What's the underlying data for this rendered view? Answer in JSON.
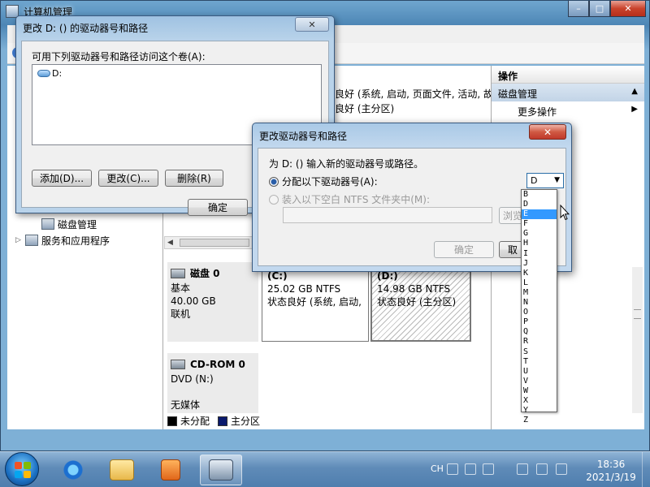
{
  "main_window": {
    "title": "计算机管理",
    "controls": {
      "minimize": "–",
      "maximize": "□",
      "close": "✕"
    }
  },
  "tree": {
    "items": [
      {
        "label": "磁盘管理",
        "icon": "disk-management-icon"
      },
      {
        "label": "服务和应用程序",
        "icon": "services-icon",
        "expander": "▷"
      }
    ]
  },
  "volume_list": {
    "status_rows": [
      "良好 (系统, 启动, 页面文件, 活动, 故",
      "良好 (主分区)"
    ]
  },
  "disks": [
    {
      "name": "磁盘 0",
      "type": "基本",
      "size": "40.00 GB",
      "state": "联机",
      "partitions": [
        {
          "label": "(C:)",
          "size": "25.02 GB NTFS",
          "status": "状态良好 (系统, 启动,"
        },
        {
          "label": "(D:)",
          "size": "14.98 GB NTFS",
          "status": "状态良好 (主分区)"
        }
      ]
    },
    {
      "name": "CD-ROM 0",
      "type": "DVD (N:)",
      "media": "无媒体"
    }
  ],
  "legend": [
    {
      "label": "未分配",
      "color": "#000000"
    },
    {
      "label": "主分区",
      "color": "#0a1a6d"
    }
  ],
  "actions": {
    "header": "操作",
    "section": "磁盘管理",
    "more": "更多操作"
  },
  "dialog1": {
    "title": "更改 D: () 的驱动器号和路径",
    "close": "✕",
    "list_label": "可用下列驱动器号和路径访问这个卷(A):",
    "entries": [
      "D:"
    ],
    "buttons": {
      "add": "添加(D)...",
      "change": "更改(C)...",
      "remove": "删除(R)",
      "ok": "确定"
    }
  },
  "dialog2": {
    "title": "更改驱动器号和路径",
    "close": "✕",
    "prompt": "为 D: () 输入新的驱动器号或路径。",
    "radio_assign": "分配以下驱动器号(A):",
    "radio_mount": "装入以下空白 NTFS 文件夹中(M):",
    "browse": "浏览",
    "ok": "确定",
    "cancel": "取",
    "combo_value": "D",
    "combo_caret": "▼"
  },
  "dropdown": {
    "options": [
      "B",
      "D",
      "E",
      "F",
      "G",
      "H",
      "I",
      "J",
      "K",
      "L",
      "M",
      "N",
      "O",
      "P",
      "Q",
      "R",
      "S",
      "T",
      "U",
      "V",
      "W",
      "X",
      "Y",
      "Z"
    ],
    "selected": "E"
  },
  "taskbar": {
    "ime": "CH",
    "time": "18:36",
    "date": "2021/3/19",
    "apps": [
      "ie-icon",
      "explorer-icon",
      "media-player-icon",
      "computer-management-icon"
    ]
  },
  "colors": {
    "primary_partition": "#0a1a6d",
    "selection": "#3399ff",
    "close_red": "#c0392b"
  }
}
